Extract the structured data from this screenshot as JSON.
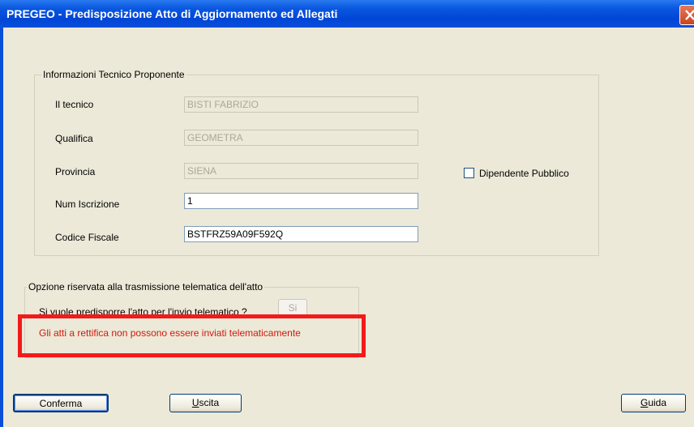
{
  "window": {
    "title": "PREGEO - Predisposizione Atto di Aggiornamento ed Allegati"
  },
  "tecnico": {
    "group_title": "Informazioni Tecnico Proponente",
    "fields": [
      {
        "label": "Il tecnico",
        "value": "BISTI FABRIZIO"
      },
      {
        "label": "Qualifica",
        "value": "GEOMETRA"
      },
      {
        "label": "Provincia",
        "value": "SIENA"
      },
      {
        "label": "Num Iscrizione",
        "value": "1"
      },
      {
        "label": "Codice Fiscale",
        "value": "BSTFRZ59A09F592Q"
      }
    ],
    "dipendente_label": "Dipendente Pubblico"
  },
  "telematica": {
    "group_title": "Opzione riservata alla trasmissione telematica dell'atto",
    "question": "Si vuole predisporre l'atto per l'invio telematico ?",
    "si_label": "Si",
    "warning": "Gli atti a rettifica non possono essere inviati telematicamente"
  },
  "buttons": {
    "conferma": "Conferma",
    "uscita_u": "U",
    "uscita_rest": "scita",
    "guida_u": "G",
    "guida_rest": "uida"
  },
  "colors": {
    "warning": "#d4180c",
    "highlight": "#f21a1a",
    "titlebar": "#0a58e0"
  }
}
